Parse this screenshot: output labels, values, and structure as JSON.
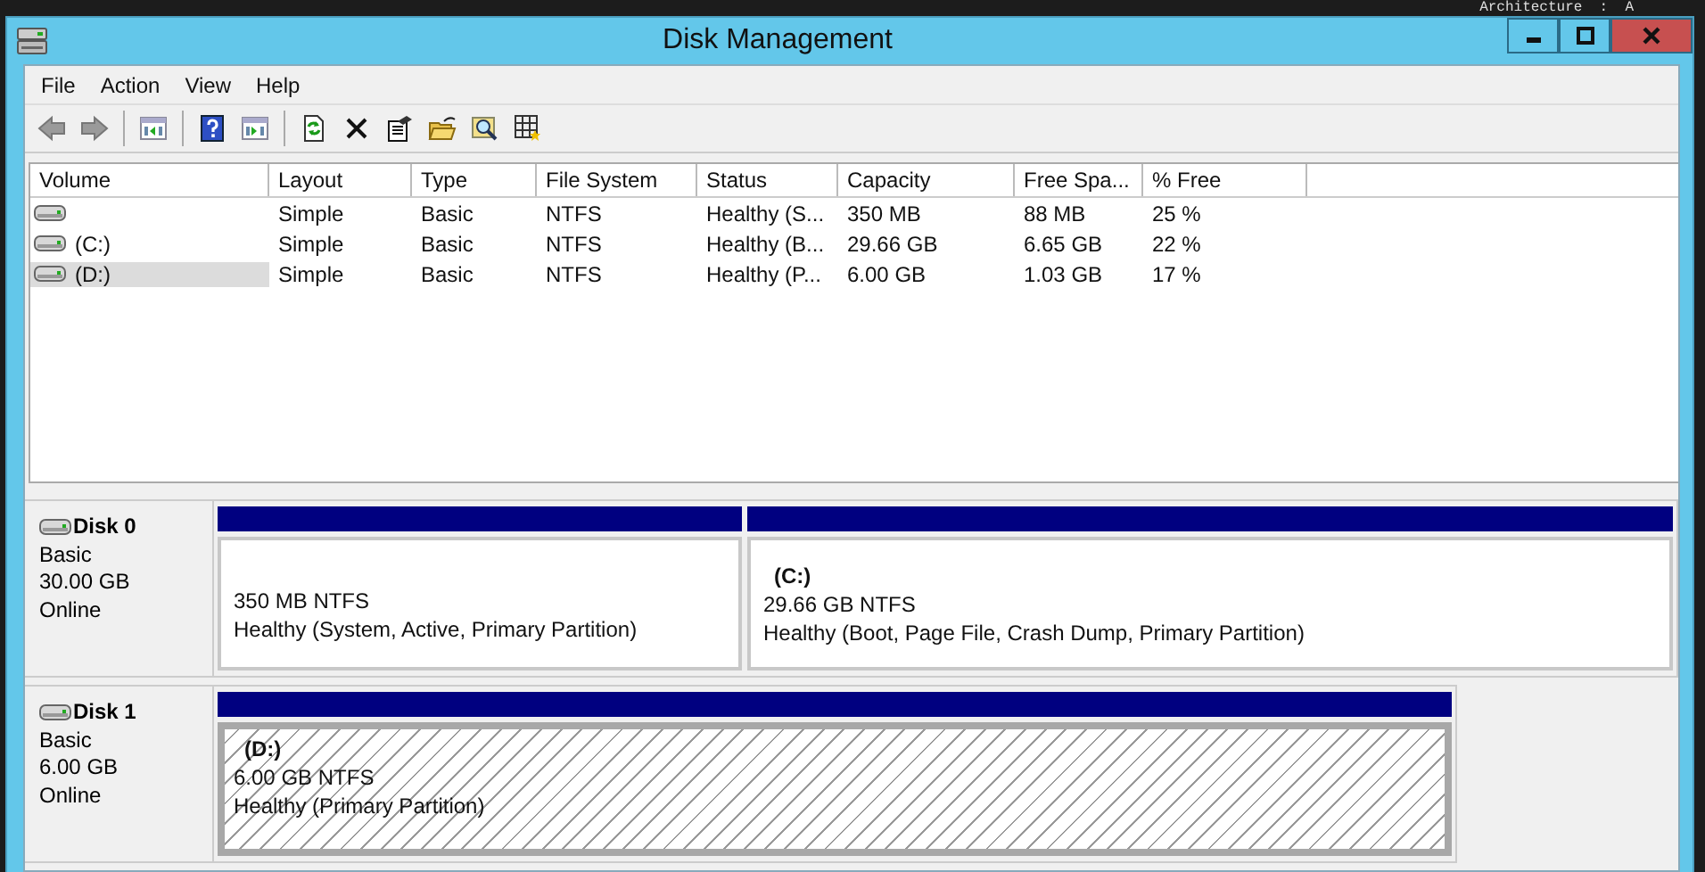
{
  "background": {
    "text": "Architecture  :  A"
  },
  "window": {
    "title": "Disk Management"
  },
  "menu": [
    "File",
    "Action",
    "View",
    "Help"
  ],
  "volume_list": {
    "columns": [
      "Volume",
      "Layout",
      "Type",
      "File System",
      "Status",
      "Capacity",
      "Free Spa...",
      "% Free"
    ],
    "rows": [
      {
        "layout": "Simple",
        "type": "Basic",
        "file_system": "NTFS",
        "status": "Healthy (S...",
        "capacity": "350 MB",
        "free_space": "88 MB",
        "percent_free": "25 %",
        "selected": false
      },
      {
        "volume": "(C:)",
        "layout": "Simple",
        "type": "Basic",
        "file_system": "NTFS",
        "status": "Healthy (B...",
        "capacity": "29.66 GB",
        "free_space": "6.65 GB",
        "percent_free": "22 %",
        "selected": false
      },
      {
        "volume": "(D:)",
        "layout": "Simple",
        "type": "Basic",
        "file_system": "NTFS",
        "status": "Healthy (P...",
        "capacity": "6.00 GB",
        "free_space": "1.03 GB",
        "percent_free": "17 %",
        "selected": true
      }
    ]
  },
  "disks": [
    {
      "name": "Disk 0",
      "type": "Basic",
      "size": "30.00 GB",
      "status": "Online",
      "partitions": [
        {
          "size_fs": "350 MB NTFS",
          "status": "Healthy (System, Active, Primary Partition)",
          "selected": false
        },
        {
          "label": "(C:)",
          "size_fs": "29.66 GB NTFS",
          "status": "Healthy (Boot, Page File, Crash Dump, Primary Partition)",
          "selected": false
        }
      ]
    },
    {
      "name": "Disk 1",
      "type": "Basic",
      "size": "6.00 GB",
      "status": "Online",
      "partitions": [
        {
          "label": "(D:)",
          "size_fs": "6.00 GB NTFS",
          "status": "Healthy (Primary Partition)",
          "selected": true
        }
      ]
    }
  ]
}
